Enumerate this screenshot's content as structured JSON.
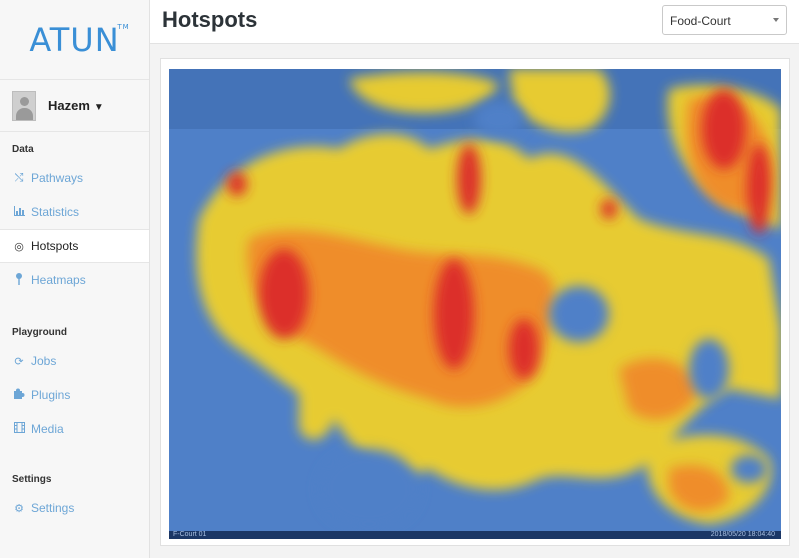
{
  "logo": {
    "text": "ATUN",
    "tm": "TM"
  },
  "user": {
    "name": "Hazem"
  },
  "sidebar": {
    "sections": [
      {
        "label": "Data"
      },
      {
        "label": "Playground"
      },
      {
        "label": "Settings"
      }
    ],
    "items": [
      {
        "label": "Pathways",
        "icon": "shuffle-icon"
      },
      {
        "label": "Statistics",
        "icon": "bar-chart-icon"
      },
      {
        "label": "Hotspots",
        "icon": "target-icon",
        "active": true
      },
      {
        "label": "Heatmaps",
        "icon": "pin-icon"
      },
      {
        "label": "Jobs",
        "icon": "refresh-icon"
      },
      {
        "label": "Plugins",
        "icon": "puzzle-icon"
      },
      {
        "label": "Media",
        "icon": "film-icon"
      },
      {
        "label": "Settings",
        "icon": "gear-icon"
      }
    ]
  },
  "header": {
    "title": "Hotspots"
  },
  "location_select": {
    "value": "Food-Court"
  },
  "camera": {
    "label_left": "F-Court 01",
    "label_right": "2018/05/20 18:04:40"
  },
  "colors": {
    "accent": "#3a8fd6",
    "heat_low": "#4f80c8",
    "heat_mid": "#f0d02c",
    "heat_high": "#f08a2a",
    "heat_peak": "#dc2a2a"
  }
}
